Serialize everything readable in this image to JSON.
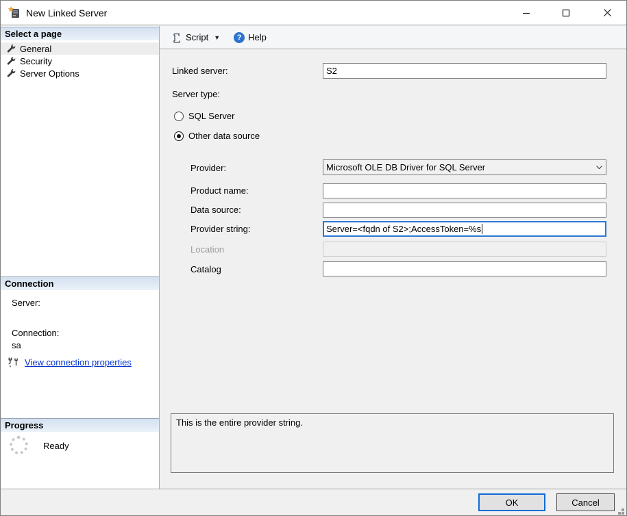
{
  "window": {
    "title": "New Linked Server"
  },
  "sidebar": {
    "select_page_header": "Select a page",
    "pages": [
      {
        "label": "General"
      },
      {
        "label": "Security"
      },
      {
        "label": "Server Options"
      }
    ],
    "connection_header": "Connection",
    "server_label": "Server:",
    "connection_label": "Connection:",
    "connection_value": "sa",
    "view_connection_link": "View connection properties",
    "progress_header": "Progress",
    "progress_status": "Ready"
  },
  "toolbar": {
    "script_label": "Script",
    "help_label": "Help",
    "help_glyph": "?"
  },
  "form": {
    "linked_server_label": "Linked server:",
    "linked_server_value": "S2",
    "server_type_label": "Server type:",
    "radio_sql_server_label": "SQL Server",
    "radio_other_label": "Other data source",
    "provider_label": "Provider:",
    "provider_value": "Microsoft OLE DB Driver for SQL Server",
    "product_name_label": "Product name:",
    "product_name_value": "",
    "data_source_label": "Data source:",
    "data_source_value": "",
    "provider_string_label": "Provider string:",
    "provider_string_value": "Server=<fqdn of S2>;AccessToken=%s",
    "location_label": "Location",
    "location_value": "",
    "catalog_label": "Catalog",
    "catalog_value": "",
    "description_text": "This is the entire provider string."
  },
  "footer": {
    "ok_label": "OK",
    "cancel_label": "Cancel"
  },
  "colors": {
    "accent": "#0f6cd6",
    "link": "#0533cc",
    "header_gradient_top": "#d4e1f0",
    "header_gradient_bottom": "#eaf1f9"
  }
}
